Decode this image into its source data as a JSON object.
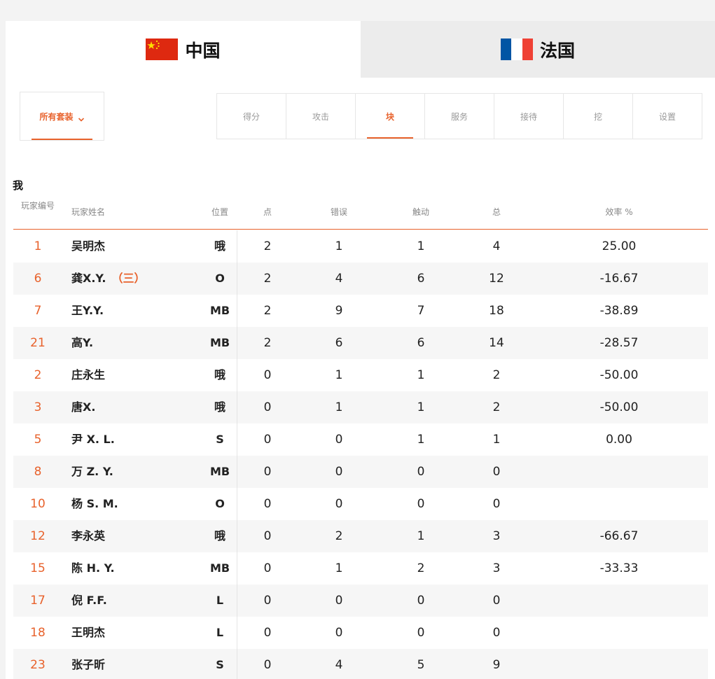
{
  "teams": [
    {
      "name": "中国",
      "flag": "cn-flag-icon",
      "active": true
    },
    {
      "name": "法国",
      "flag": "fr-flag-icon",
      "active": false
    }
  ],
  "colors": {
    "accent": "#e8622c",
    "cn_red": "#de2910",
    "cn_yellow": "#ffde00",
    "fr_blue": "#0055a4",
    "fr_white": "#ffffff",
    "fr_red": "#ef4135"
  },
  "filter": {
    "label": "所有套装"
  },
  "stat_tabs": [
    "得分",
    "攻击",
    "块",
    "服务",
    "接待",
    "挖",
    "设置"
  ],
  "active_stat_tab": 2,
  "section_title": "我",
  "headers": {
    "num": "玩家编号",
    "name": "玩家姓名",
    "pos": "位置",
    "pts": "点",
    "err": "错误",
    "tch": "触动",
    "tot": "总",
    "eff": "效率 %"
  },
  "players": [
    {
      "num": "1",
      "name": "吴明杰",
      "tag": "",
      "pos": "哦",
      "pts": "2",
      "err": "1",
      "tch": "1",
      "tot": "4",
      "eff": "25.00"
    },
    {
      "num": "6",
      "name": "龚X.Y.",
      "tag": "（三）",
      "pos": "O",
      "pts": "2",
      "err": "4",
      "tch": "6",
      "tot": "12",
      "eff": "-16.67"
    },
    {
      "num": "7",
      "name": "王Y.Y.",
      "tag": "",
      "pos": "MB",
      "pts": "2",
      "err": "9",
      "tch": "7",
      "tot": "18",
      "eff": "-38.89"
    },
    {
      "num": "21",
      "name": "高Y.",
      "tag": "",
      "pos": "MB",
      "pts": "2",
      "err": "6",
      "tch": "6",
      "tot": "14",
      "eff": "-28.57"
    },
    {
      "num": "2",
      "name": "庄永生",
      "tag": "",
      "pos": "哦",
      "pts": "0",
      "err": "1",
      "tch": "1",
      "tot": "2",
      "eff": "-50.00"
    },
    {
      "num": "3",
      "name": "唐X.",
      "tag": "",
      "pos": "哦",
      "pts": "0",
      "err": "1",
      "tch": "1",
      "tot": "2",
      "eff": "-50.00"
    },
    {
      "num": "5",
      "name": "尹 X. L.",
      "tag": "",
      "pos": "S",
      "pts": "0",
      "err": "0",
      "tch": "1",
      "tot": "1",
      "eff": "0.00"
    },
    {
      "num": "8",
      "name": "万 Z. Y.",
      "tag": "",
      "pos": "MB",
      "pts": "0",
      "err": "0",
      "tch": "0",
      "tot": "0",
      "eff": ""
    },
    {
      "num": "10",
      "name": "杨 S. M.",
      "tag": "",
      "pos": "O",
      "pts": "0",
      "err": "0",
      "tch": "0",
      "tot": "0",
      "eff": ""
    },
    {
      "num": "12",
      "name": "李永英",
      "tag": "",
      "pos": "哦",
      "pts": "0",
      "err": "2",
      "tch": "1",
      "tot": "3",
      "eff": "-66.67"
    },
    {
      "num": "15",
      "name": "陈 H. Y.",
      "tag": "",
      "pos": "MB",
      "pts": "0",
      "err": "1",
      "tch": "2",
      "tot": "3",
      "eff": "-33.33"
    },
    {
      "num": "17",
      "name": "倪 F.F.",
      "tag": "",
      "pos": "L",
      "pts": "0",
      "err": "0",
      "tch": "0",
      "tot": "0",
      "eff": ""
    },
    {
      "num": "18",
      "name": "王明杰",
      "tag": "",
      "pos": "L",
      "pts": "0",
      "err": "0",
      "tch": "0",
      "tot": "0",
      "eff": ""
    },
    {
      "num": "23",
      "name": "张子昕",
      "tag": "",
      "pos": "S",
      "pts": "0",
      "err": "4",
      "tch": "5",
      "tot": "9",
      "eff": ""
    }
  ]
}
